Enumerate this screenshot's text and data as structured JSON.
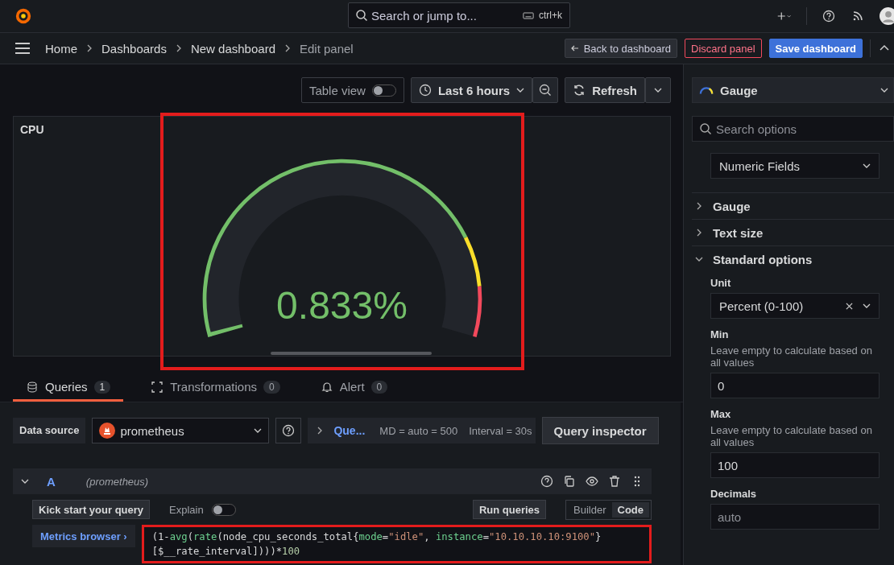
{
  "topbar": {
    "search_placeholder": "Search or jump to...",
    "shortcut": "ctrl+k"
  },
  "breadcrumbs": [
    {
      "label": "Home",
      "current": false
    },
    {
      "label": "Dashboards",
      "current": false
    },
    {
      "label": "New dashboard",
      "current": false
    },
    {
      "label": "Edit panel",
      "current": true
    }
  ],
  "header_buttons": [
    {
      "label": "Back to dashboard",
      "kind": "back"
    },
    {
      "label": "Discard panel",
      "kind": "danger"
    },
    {
      "label": "Save dashboard",
      "kind": "primary"
    }
  ],
  "toolbar": {
    "table_view": {
      "label": "Table view",
      "on": false
    },
    "time_range": "Last 6 hours",
    "refresh": "Refresh"
  },
  "panel": {
    "title": "CPU",
    "highlighted": true,
    "gauge": {
      "value": "0.833%",
      "level": 0.00833,
      "threshold_bands": [
        {
          "color": "#73bf69"
        },
        {
          "color": "#fade2a"
        },
        {
          "color": "#f2495c"
        }
      ]
    }
  },
  "tabs": [
    {
      "label": "Queries",
      "count": "1",
      "selected": true
    },
    {
      "label": "Transformations",
      "count": "0",
      "selected": false
    },
    {
      "label": "Alert",
      "count": "0",
      "selected": false
    }
  ],
  "query_bar": {
    "data_source_label": "Data source",
    "data_source": "prometheus",
    "options_label": "Que...",
    "md": "MD = auto = 500",
    "interval": "Interval = 30s",
    "inspector": "Query inspector"
  },
  "query": {
    "ref": "A",
    "source": "(prometheus)",
    "expanded": true,
    "kick_start": "Kick start your query",
    "explain": {
      "label": "Explain",
      "on": false
    },
    "run": "Run queries",
    "modes": [
      {
        "label": "Builder",
        "selected": false
      },
      {
        "label": "Code",
        "selected": true
      }
    ],
    "metrics_browser": "Metrics browser ›",
    "highlighted": true,
    "code_lines": [
      [
        {
          "text": "(1-",
          "kind": "plain"
        },
        {
          "text": "avg",
          "kind": "func"
        },
        {
          "text": "(",
          "kind": "plain"
        },
        {
          "text": "rate",
          "kind": "func"
        },
        {
          "text": "(node_cpu_seconds_total{",
          "kind": "plain"
        },
        {
          "text": "mode",
          "kind": "label"
        },
        {
          "text": "=",
          "kind": "plain"
        },
        {
          "text": "\"idle\"",
          "kind": "string"
        },
        {
          "text": ", ",
          "kind": "plain"
        },
        {
          "text": "instance",
          "kind": "label"
        },
        {
          "text": "=",
          "kind": "plain"
        },
        {
          "text": "\"10.10.10.10:9100\"",
          "kind": "string"
        },
        {
          "text": "}",
          "kind": "plain"
        }
      ],
      [
        {
          "text": "[$__rate_interval]))",
          "kind": "plain"
        },
        {
          "text": ")*",
          "kind": "plain"
        },
        {
          "text": "100",
          "kind": "number"
        }
      ]
    ]
  },
  "sidebar": {
    "visualization": "Gauge",
    "search_placeholder": "Search options",
    "calc_field": "Numeric Fields",
    "sections": [
      {
        "label": "Gauge",
        "expanded": false
      },
      {
        "label": "Text size",
        "expanded": false
      },
      {
        "label": "Standard options",
        "expanded": true
      }
    ],
    "unit": {
      "label": "Unit",
      "value": "Percent (0-100)"
    },
    "min": {
      "label": "Min",
      "hint": "Leave empty to calculate based on all values",
      "value": "0"
    },
    "max": {
      "label": "Max",
      "hint": "Leave empty to calculate based on all values",
      "value": "100"
    },
    "decimals": {
      "label": "Decimals",
      "placeholder": "auto"
    }
  }
}
